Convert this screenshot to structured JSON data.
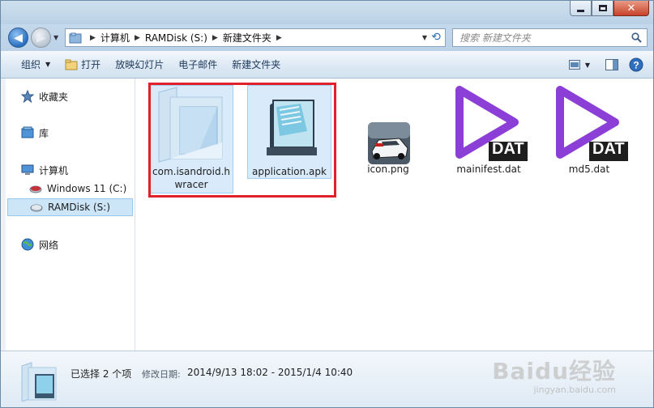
{
  "address": {
    "crumbs": [
      "计算机",
      "RAMDisk (S:)",
      "新建文件夹"
    ]
  },
  "search": {
    "placeholder": "搜索 新建文件夹"
  },
  "toolbar": {
    "organize": "组织",
    "open": "打开",
    "slideshow": "放映幻灯片",
    "email": "电子邮件",
    "new_folder": "新建文件夹"
  },
  "nav": {
    "favorites": "收藏夹",
    "libraries": "库",
    "computer": "计算机",
    "drive_c": "Windows 11 (C:)",
    "drive_s": "RAMDisk (S:)",
    "network": "网络"
  },
  "files": [
    {
      "name": "com.isandroid.hwracer",
      "icon": "folder-icon",
      "selected": true
    },
    {
      "name": "application.apk",
      "icon": "notepad-icon",
      "selected": true
    },
    {
      "name": "icon.png",
      "icon": "car-image-icon",
      "selected": false
    },
    {
      "name": "mainifest.dat",
      "icon": "dat-file-icon",
      "selected": false
    },
    {
      "name": "md5.dat",
      "icon": "dat-file-icon",
      "selected": false
    }
  ],
  "file_labels": {
    "folder_line1": "com.isandroid.h",
    "folder_line2": "wracer",
    "dat_badge": "DAT"
  },
  "details": {
    "count": "已选择 2 个项",
    "date_label": "修改日期:",
    "date_range": "2014/9/13 18:02 - 2015/1/4 10:40"
  },
  "watermark": {
    "main": "Baidu经验",
    "sub": "jingyan.baidu.com"
  },
  "colors": {
    "highlight": "#e0202a",
    "dat_purple": "#8b3fd6",
    "selection": "#d9ebfa"
  }
}
